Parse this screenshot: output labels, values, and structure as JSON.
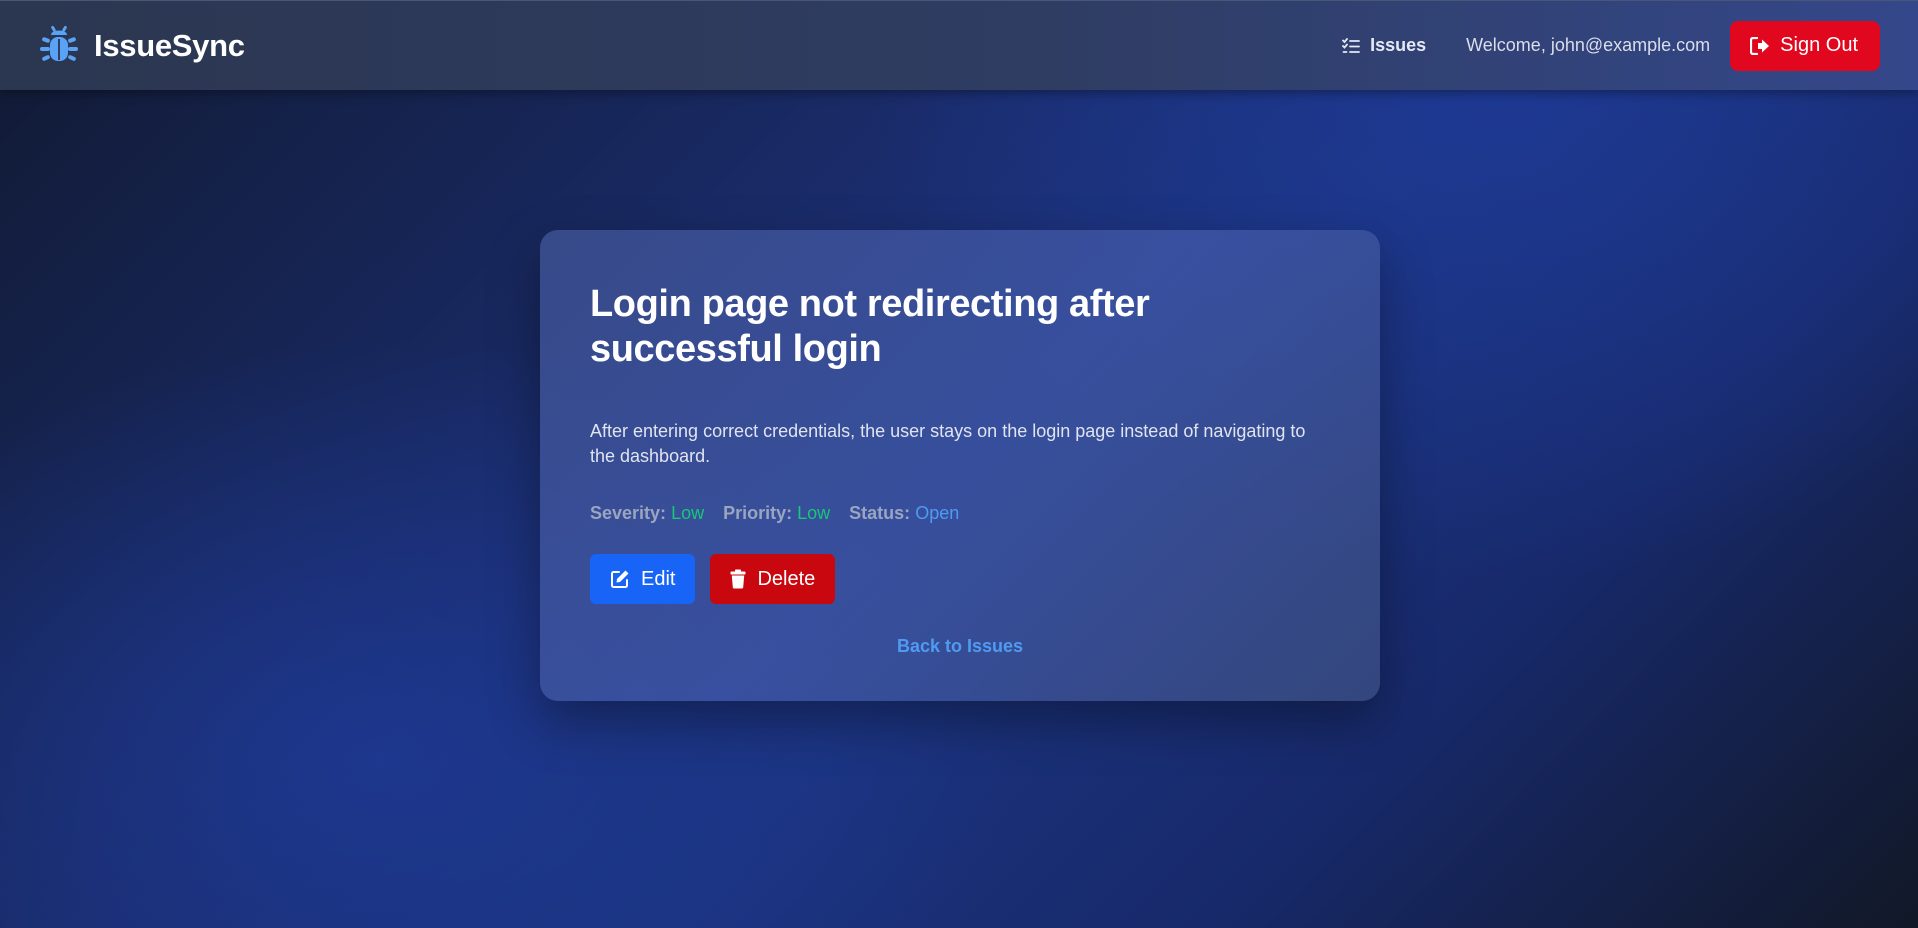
{
  "app": {
    "name": "IssueSync",
    "brand_icon": "bug-icon"
  },
  "header": {
    "nav_issues_label": "Issues",
    "nav_issues_icon": "list-check-icon",
    "welcome_text": "Welcome, john@example.com",
    "signout_label": "Sign Out",
    "signout_icon": "sign-out-icon"
  },
  "issue": {
    "title": "Login page not redirecting after successful login",
    "description": "After entering correct credentials, the user stays on the login page instead of navigating to the dashboard.",
    "severity_label": "Severity:",
    "severity_value": "Low",
    "priority_label": "Priority:",
    "priority_value": "Low",
    "status_label": "Status:",
    "status_value": "Open"
  },
  "actions": {
    "edit_label": "Edit",
    "edit_icon": "edit-icon",
    "delete_label": "Delete",
    "delete_icon": "trash-icon"
  },
  "back_link_label": "Back to Issues",
  "colors": {
    "accent_blue": "#1864f7",
    "danger_red": "#e0071f",
    "delete_red": "#c8070e",
    "low_green": "#18c77a",
    "link_blue": "#4f9bf2",
    "brand_icon_blue": "#5aa2f5"
  }
}
